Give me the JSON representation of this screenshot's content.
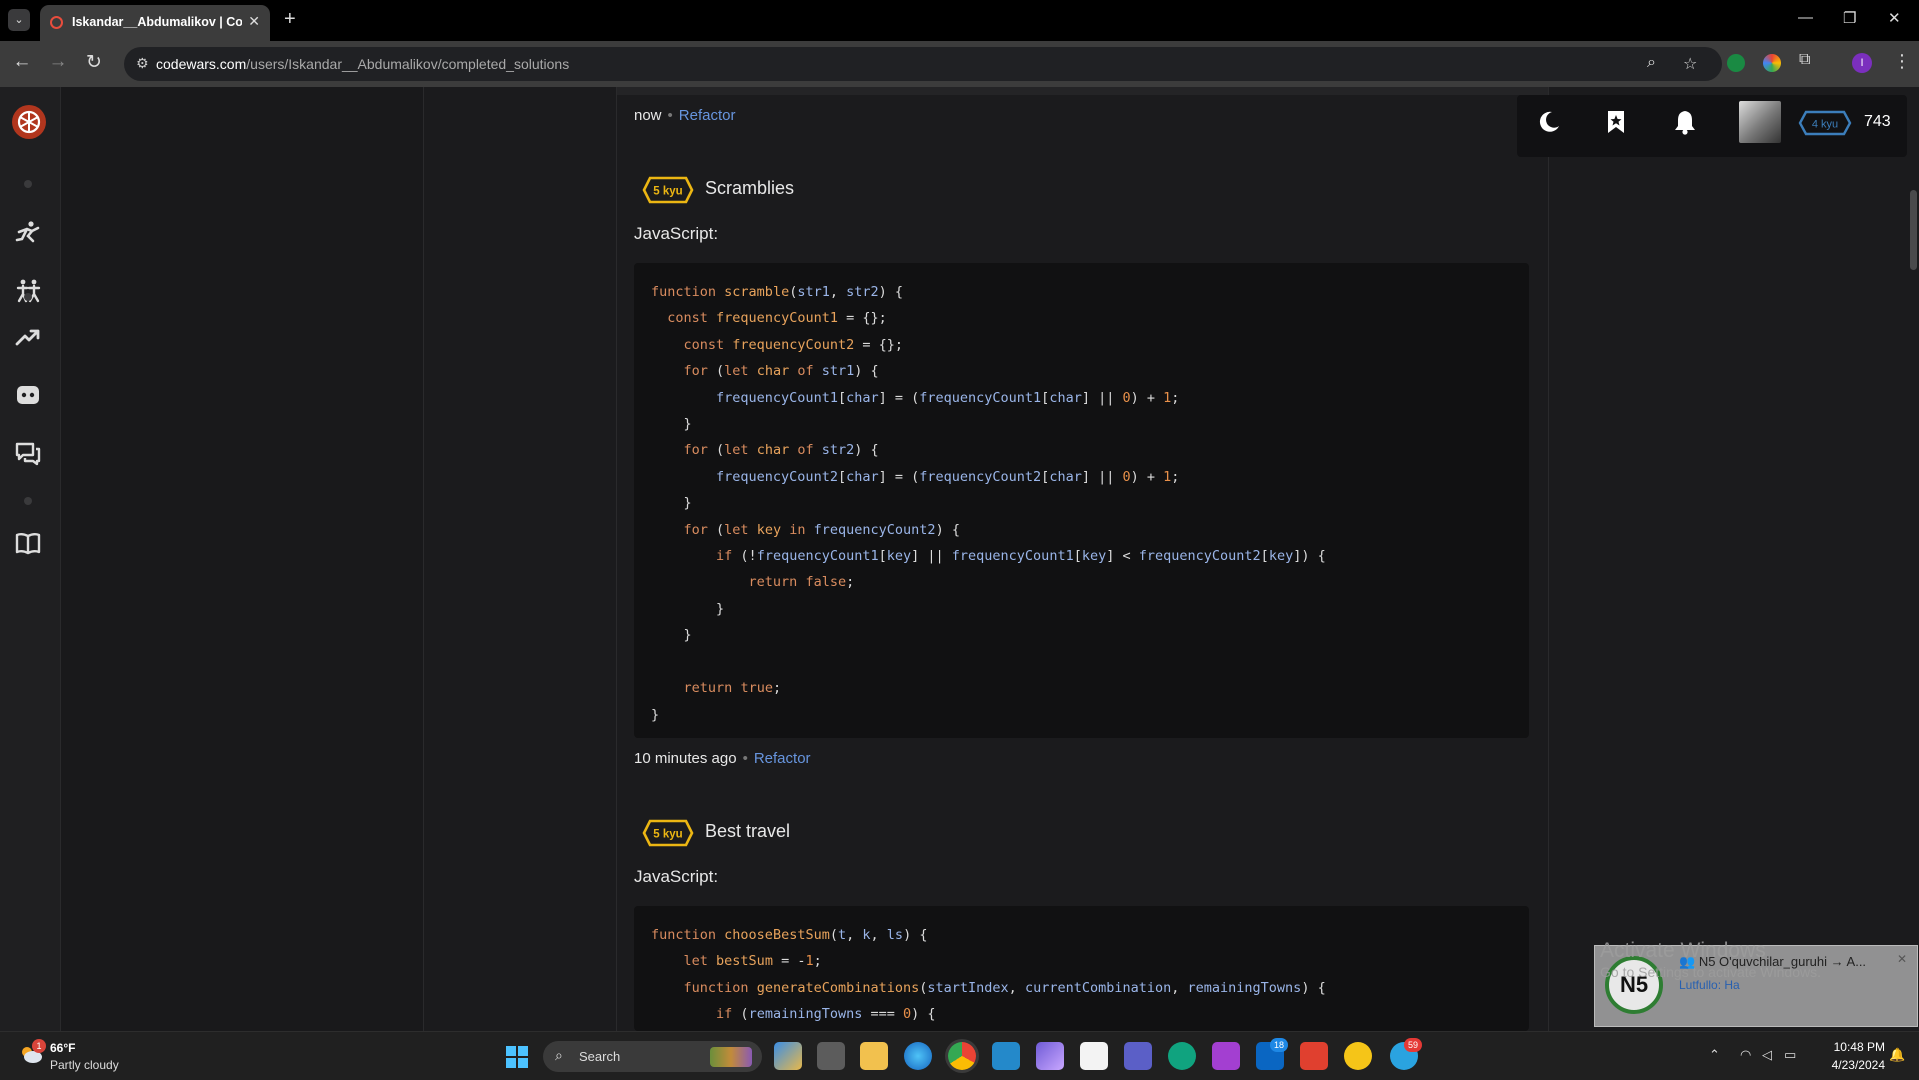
{
  "browser": {
    "tab_title": "Iskandar__Abdumalikov | Codewars",
    "url_host": "codewars.com",
    "url_path": "/users/Iskandar__Abdumalikov/completed_solutions"
  },
  "user_bar": {
    "rank": "4 kyu",
    "honor": "743"
  },
  "solutions": [
    {
      "time": "now",
      "action": "Refactor"
    },
    {
      "kyu": "5 kyu",
      "title": "Scramblies",
      "language": "JavaScript:",
      "time": "10 minutes ago",
      "action": "Refactor"
    },
    {
      "kyu": "5 kyu",
      "title": "Best travel",
      "language": "JavaScript:"
    }
  ],
  "notification": {
    "activate_title": "Activate Windows",
    "activate_sub": "Go to Settings to activate Windows.",
    "title": "N5 O'quvchilar_guruhi → A...",
    "message": "Lutfullo: Ha",
    "avatar_text": "N5"
  },
  "taskbar": {
    "temperature": "66°F",
    "weather": "Partly cloudy",
    "search_placeholder": "Search",
    "time": "10:48 PM",
    "date": "4/23/2024",
    "weather_badge": "1",
    "linkedin_badge": "18",
    "telegram_badge": "59"
  },
  "colors": {
    "accent_link": "#6795de",
    "kyu_yellow": "#ecb613",
    "rank_blue": "#3c7ebb",
    "brand_red": "#b1361e"
  }
}
